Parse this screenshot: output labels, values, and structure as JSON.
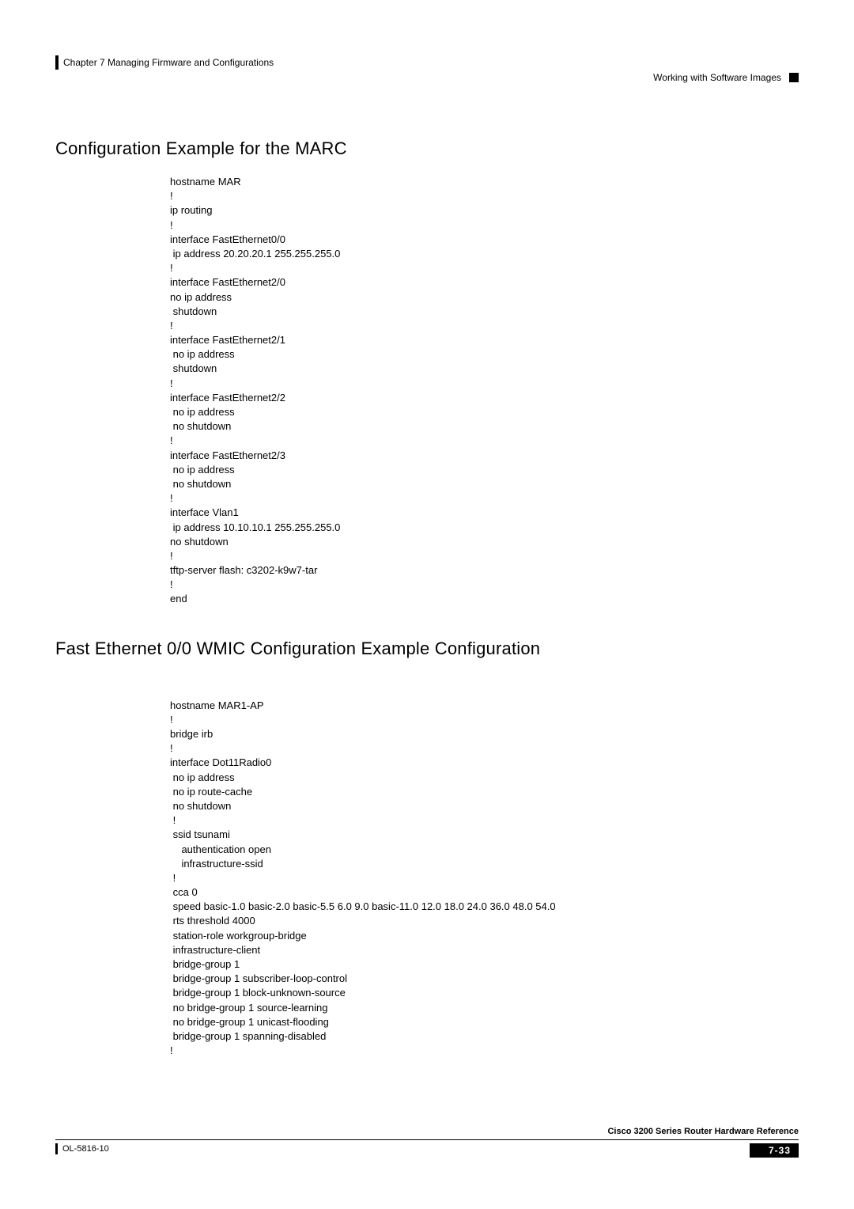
{
  "header": {
    "chapter": "Chapter 7     Managing Firmware and Configurations",
    "right": "Working with Software Images"
  },
  "section1": {
    "heading": "Configuration Example for the MARC",
    "config": "hostname MAR\n!\nip routing\n!\ninterface FastEthernet0/0\n ip address 20.20.20.1 255.255.255.0\n!\ninterface FastEthernet2/0\nno ip address\n shutdown\n!\ninterface FastEthernet2/1\n no ip address\n shutdown\n!\ninterface FastEthernet2/2\n no ip address\n no shutdown\n!\ninterface FastEthernet2/3\n no ip address\n no shutdown\n!\ninterface Vlan1\n ip address 10.10.10.1 255.255.255.0\nno shutdown\n!\ntftp-server flash: c3202-k9w7-tar\n!\nend"
  },
  "section2": {
    "heading": "Fast Ethernet 0/0 WMIC Configuration Example Configuration",
    "config": "hostname MAR1-AP\n!\nbridge irb\n!\ninterface Dot11Radio0\n no ip address\n no ip route-cache\n no shutdown\n !\n ssid tsunami\n    authentication open\n    infrastructure-ssid\n !\n cca 0\n speed basic-1.0 basic-2.0 basic-5.5 6.0 9.0 basic-11.0 12.0 18.0 24.0 36.0 48.0 54.0\n rts threshold 4000\n station-role workgroup-bridge\n infrastructure-client\n bridge-group 1\n bridge-group 1 subscriber-loop-control\n bridge-group 1 block-unknown-source\n no bridge-group 1 source-learning\n no bridge-group 1 unicast-flooding\n bridge-group 1 spanning-disabled\n!"
  },
  "footer": {
    "left": "OL-5816-10",
    "reference": "Cisco 3200 Series Router Hardware Reference",
    "page": "7-33"
  }
}
